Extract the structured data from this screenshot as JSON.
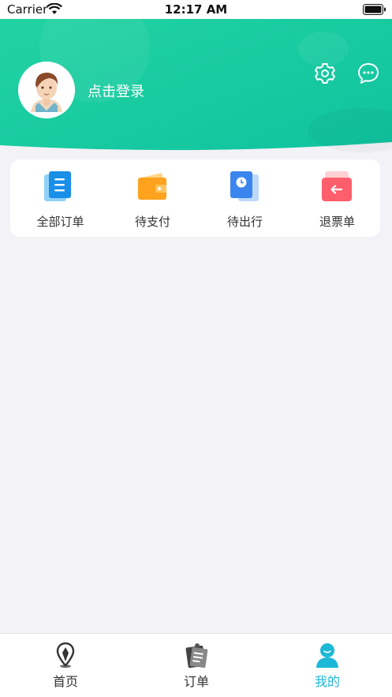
{
  "status_bar": {
    "carrier": "Carrier",
    "time": "12:17 AM"
  },
  "header": {
    "login_label": "点击登录",
    "gradient_start": "#25d3a0",
    "gradient_end": "#12c6a0"
  },
  "orders": {
    "items": [
      {
        "label": "全部订单",
        "icon": "document-list-icon",
        "color": "#1e8ff0"
      },
      {
        "label": "待支付",
        "icon": "wallet-icon",
        "color": "#ff9a1a"
      },
      {
        "label": "待出行",
        "icon": "clock-card-icon",
        "color": "#3b82f0"
      },
      {
        "label": "退票单",
        "icon": "refund-arrow-icon",
        "color": "#ff5a66"
      }
    ]
  },
  "tabbar": {
    "items": [
      {
        "label": "首页",
        "icon": "home-pin-icon",
        "active": false
      },
      {
        "label": "订单",
        "icon": "order-clipboard-icon",
        "active": false
      },
      {
        "label": "我的",
        "icon": "profile-icon",
        "active": true
      }
    ],
    "active_color": "#1cb8d8"
  }
}
